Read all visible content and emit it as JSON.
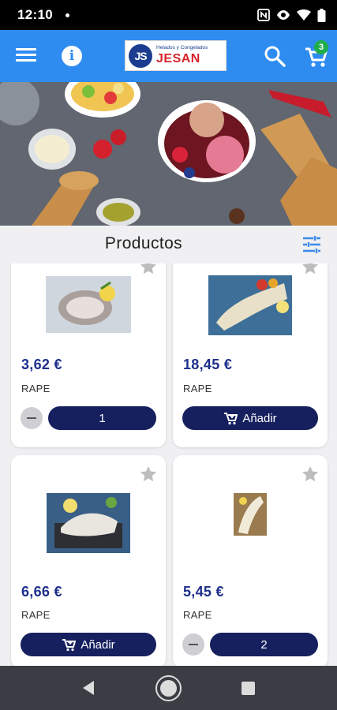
{
  "status_bar": {
    "time": "12:10"
  },
  "app_bar": {
    "menu_icon": "menu-icon",
    "info_icon": "info-icon",
    "logo": {
      "subtitle": "Helados y Congelados",
      "name": "JESAN",
      "mark": "JS"
    },
    "search_icon": "search-icon",
    "cart_icon": "cart-icon",
    "cart_count": "3",
    "colors": {
      "primary": "#2e8cf1",
      "badge": "#1fae4b"
    }
  },
  "section": {
    "title": "Productos",
    "filter_icon": "tune-icon"
  },
  "products": [
    {
      "price": "3,62 €",
      "name": "RAPE",
      "action": "qty",
      "qty": "1"
    },
    {
      "price": "18,45 €",
      "name": "RAPE",
      "action": "add",
      "add_label": "Añadir"
    },
    {
      "price": "6,66 €",
      "name": "RAPE",
      "action": "add",
      "add_label": "Añadir"
    },
    {
      "price": "5,45 €",
      "name": "RAPE",
      "action": "qty",
      "qty": "2"
    }
  ],
  "colors": {
    "price": "#1e2f8c",
    "button": "#16205e"
  }
}
